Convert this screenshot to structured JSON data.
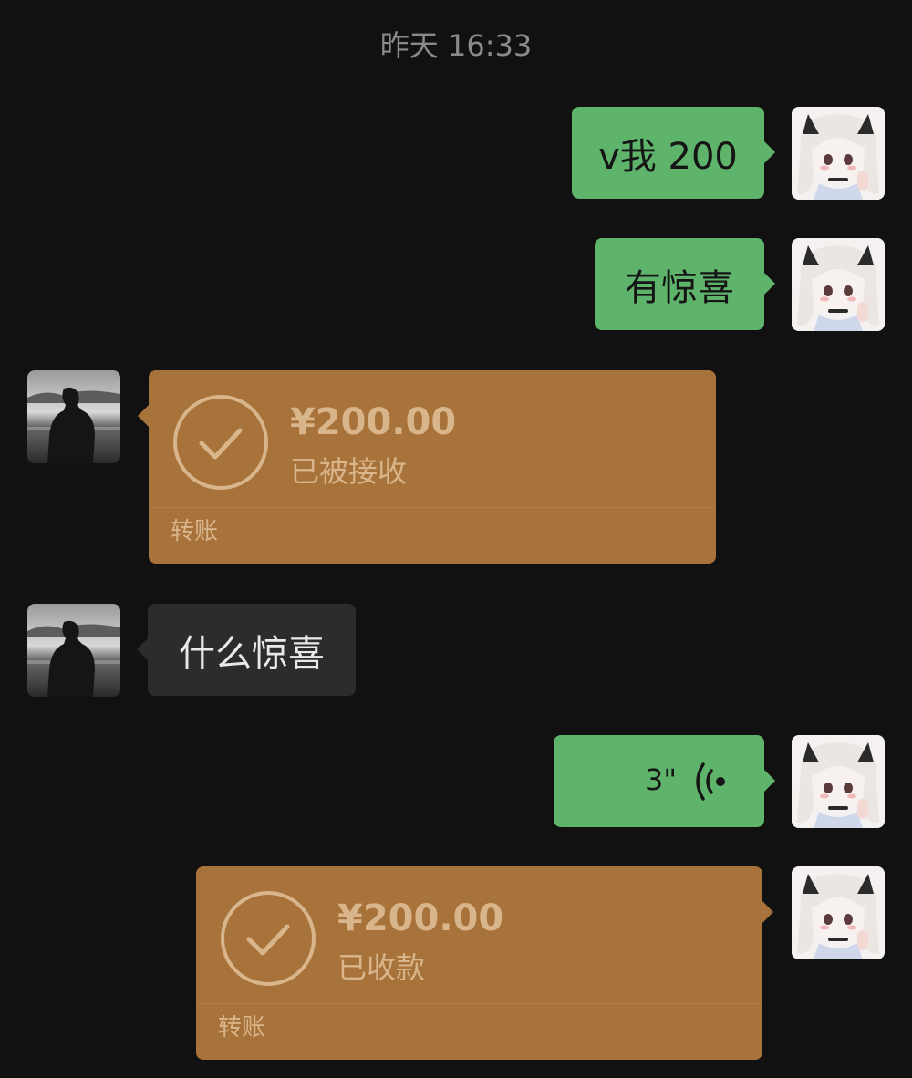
{
  "timestamp": "昨天 16:33",
  "colors": {
    "background": "#111111",
    "sent_bubble": "#5fb46b",
    "received_bubble": "#2c2c2c",
    "transfer_bubble": "#a8733b",
    "transfer_text": "#d9b58b",
    "timestamp_text": "#8a8a8a"
  },
  "messages": [
    {
      "id": "m1",
      "side": "right",
      "type": "text",
      "text": "v我 200",
      "avatar": "anime-girl-avatar"
    },
    {
      "id": "m2",
      "side": "right",
      "type": "text",
      "text": "有惊喜",
      "avatar": "anime-girl-avatar"
    },
    {
      "id": "m3",
      "side": "left",
      "type": "transfer",
      "amount": "¥200.00",
      "status": "已被接收",
      "footer": "转账",
      "icon": "check-circle-icon",
      "avatar": "silhouette-man-avatar"
    },
    {
      "id": "m4",
      "side": "left",
      "type": "text",
      "text": "什么惊喜",
      "avatar": "silhouette-man-avatar"
    },
    {
      "id": "m5",
      "side": "right",
      "type": "voice",
      "duration": "3\"",
      "icon": "voice-wave-icon",
      "avatar": "anime-girl-avatar"
    },
    {
      "id": "m6",
      "side": "right",
      "type": "transfer",
      "amount": "¥200.00",
      "status": "已收款",
      "footer": "转账",
      "icon": "check-circle-icon",
      "avatar": "anime-girl-avatar"
    }
  ]
}
